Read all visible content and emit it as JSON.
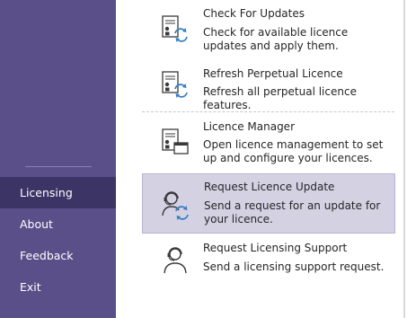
{
  "sidebar": {
    "items": [
      {
        "label": "Licensing",
        "active": true
      },
      {
        "label": "About"
      },
      {
        "label": "Feedback"
      },
      {
        "label": "Exit"
      }
    ]
  },
  "main": {
    "items": [
      {
        "title": "Check For Updates",
        "description": "Check for available licence updates and apply them.",
        "icon": "document-refresh-icon"
      },
      {
        "title": "Refresh Perpetual Licence",
        "description": "Refresh all perpetual licence features.",
        "icon": "document-refresh-icon"
      },
      {
        "title": "Licence Manager",
        "description": "Open licence management to set up and configure your licences.",
        "icon": "document-window-icon"
      },
      {
        "title": "Request Licence Update",
        "description": "Send a request for an update for your licence.",
        "icon": "headset-person-refresh-icon",
        "selected": true
      },
      {
        "title": "Request Licensing Support",
        "description": "Send a licensing support request.",
        "icon": "headset-person-icon"
      }
    ]
  },
  "colors": {
    "sidebar_bg": "#5a4f88",
    "sidebar_active": "#3d3466",
    "selected_item_bg": "#d4d1e3",
    "icon_accent": "#2f7dc4"
  }
}
